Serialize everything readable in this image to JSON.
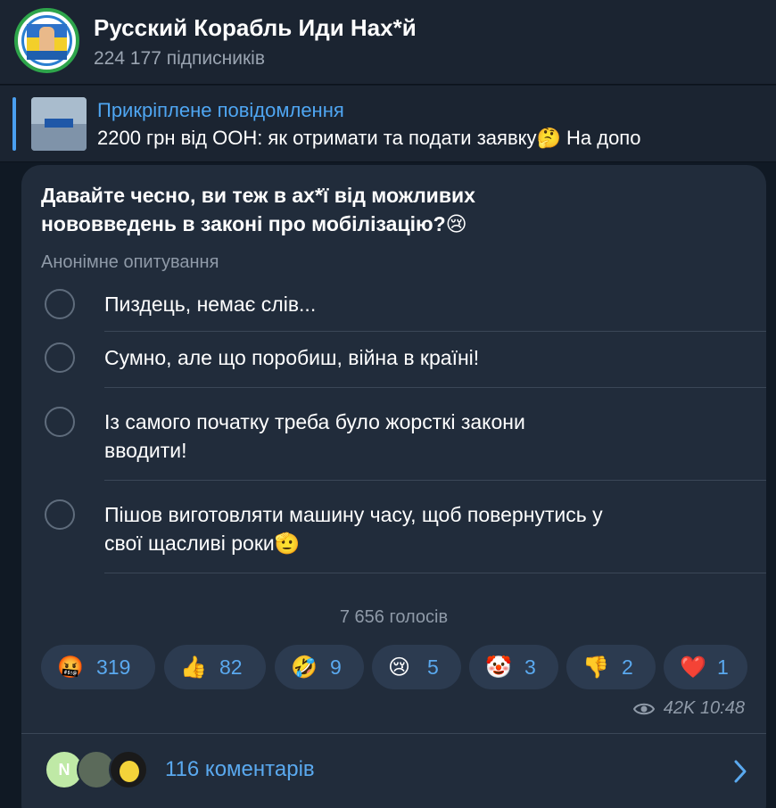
{
  "header": {
    "title": "Русский Корабль Иди Нах*й",
    "subscribers": "224 177 підписників"
  },
  "pinned": {
    "title": "Прикріплене повідомлення",
    "text": "2200 грн від ООН: як отримати та подати заявку🤔   На допо"
  },
  "poll": {
    "question": "Давайте чесно, ви теж в ах*ї від можливих нововведень в законі про мобілізацію?😢",
    "type": "Анонімне опитування",
    "options": [
      {
        "text": "Пиздець, немає слів..."
      },
      {
        "text": "Сумно, але що поробиш, війна в країні!"
      },
      {
        "text": "Із самого початку треба було жорсткі закони вводити!"
      },
      {
        "text": "Пішов виготовляти машину часу, щоб повернутись у свої щасливі роки🫡"
      }
    ],
    "votes": "7 656 голосів"
  },
  "reactions": [
    {
      "emoji": "🤬",
      "count": "319"
    },
    {
      "emoji": "👍",
      "count": "82"
    },
    {
      "emoji": "🤣",
      "count": "9"
    },
    {
      "emoji": "😢",
      "count": "5"
    },
    {
      "emoji": "🤡",
      "count": "3"
    },
    {
      "emoji": "👎",
      "count": "2"
    },
    {
      "emoji": "❤️",
      "count": "1"
    }
  ],
  "meta": {
    "views": "42K",
    "time": "10:48"
  },
  "comments": {
    "first_avatar_letter": "N",
    "label": "116 коментарів"
  },
  "colors": {
    "background": "#101924",
    "bubble": "#212c3b",
    "accent": "#5aa9ef",
    "reaction_bg": "#2c3b50"
  }
}
